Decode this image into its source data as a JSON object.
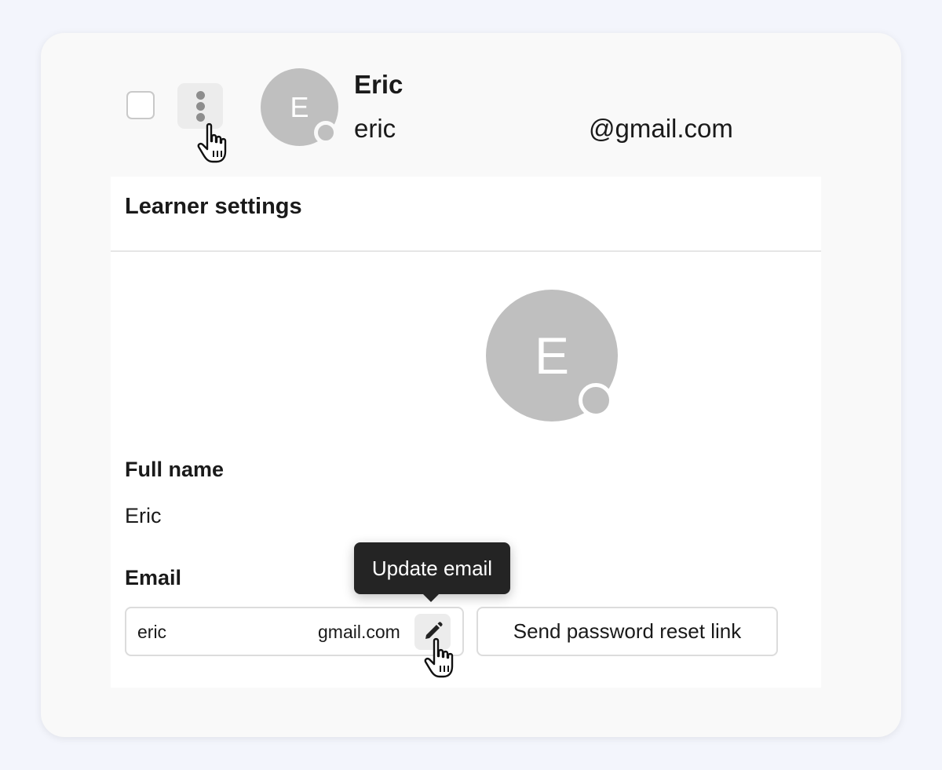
{
  "user_row": {
    "avatar_initial": "E",
    "name": "Eric",
    "username": "eric",
    "email_domain": "@gmail.com"
  },
  "panel": {
    "title": "Learner settings",
    "avatar_initial": "E",
    "full_name_label": "Full name",
    "full_name_value": "Eric",
    "email_label": "Email",
    "email_local": "eric",
    "email_domain": "gmail.com",
    "reset_button_label": "Send password reset link"
  },
  "tooltip": {
    "text": "Update email"
  },
  "icons": {
    "row_menu": "more-vertical-icon",
    "edit": "pencil-icon",
    "cursor": "hand-pointer-icon"
  },
  "colors": {
    "background": "#f3f5fc",
    "card": "#f9f9f9",
    "avatar": "#bfbfbf",
    "tooltip": "#242424"
  }
}
